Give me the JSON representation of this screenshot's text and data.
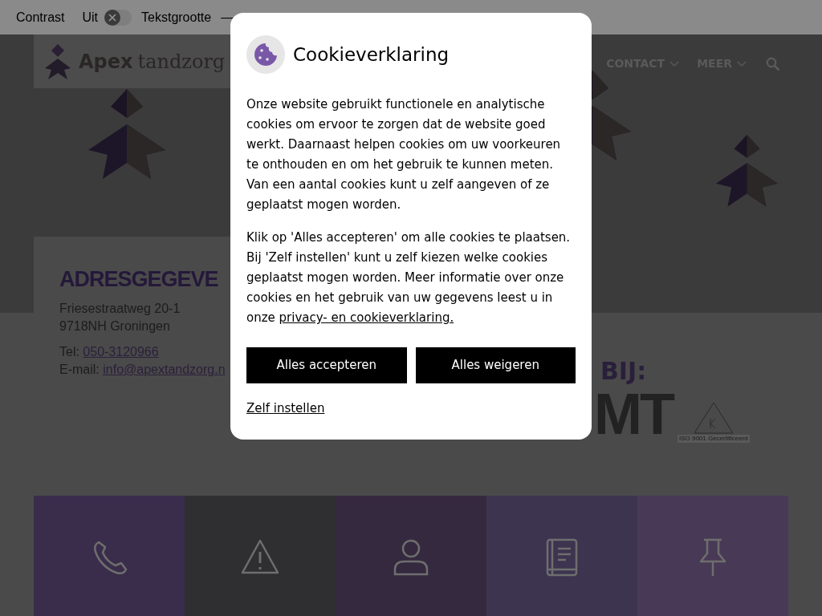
{
  "topbar": {
    "contrast_label": "Contrast",
    "contrast_state": "Uit",
    "contrast_on": false,
    "text_size_label": "Tekstgrootte",
    "text_size_minus": "—"
  },
  "header": {
    "logo": {
      "bold": "Apex",
      "light": "tandzorg"
    },
    "nav": [
      {
        "label": "CONTACT"
      },
      {
        "label": "MEER"
      }
    ]
  },
  "address": {
    "heading": "ADRESGEGEVE",
    "lines": [
      "Friesestraatweg 20-1",
      "9718NH Groningen"
    ],
    "phone_label": "Tel:",
    "phone": "050-3120966",
    "email_label": "E-mail:",
    "email": "info@apextandzorg.n"
  },
  "certification": {
    "heading": "BIJ:",
    "logo_text": "MT",
    "iso_text": "ISO 9001 Gecertificeerd"
  },
  "tiles": [
    {
      "kind": "phone",
      "color": "#3a2d4b"
    },
    {
      "kind": "warning",
      "color": "#2f2e31"
    },
    {
      "kind": "person",
      "color": "#35293f"
    },
    {
      "kind": "book",
      "color": "#3d3450"
    },
    {
      "kind": "pin",
      "color": "#483a56"
    }
  ],
  "cookie_dialog": {
    "title": "Cookieverklaring",
    "paragraphs": [
      "Onze website gebruikt functionele en analytische cookies om ervoor te zorgen dat de website goed werkt. Daarnaast helpen cookies om uw voorkeuren te onthouden en om het gebruik te kunnen meten. Van een aantal cookies kunt u zelf aangeven of ze geplaatst mogen worden.",
      "Klik op 'Alles accepteren' om alle cookies te plaatsen. Bij 'Zelf instellen' kunt u zelf kiezen welke cookies geplaatst mogen worden. Meer informatie over onze cookies en het gebruik van uw gegevens leest u in onze"
    ],
    "link": "privacy- en cookieverklaring.",
    "buttons": [
      "Alles accepteren",
      "Alles weigeren"
    ],
    "settings_link": "Zelf instellen"
  }
}
